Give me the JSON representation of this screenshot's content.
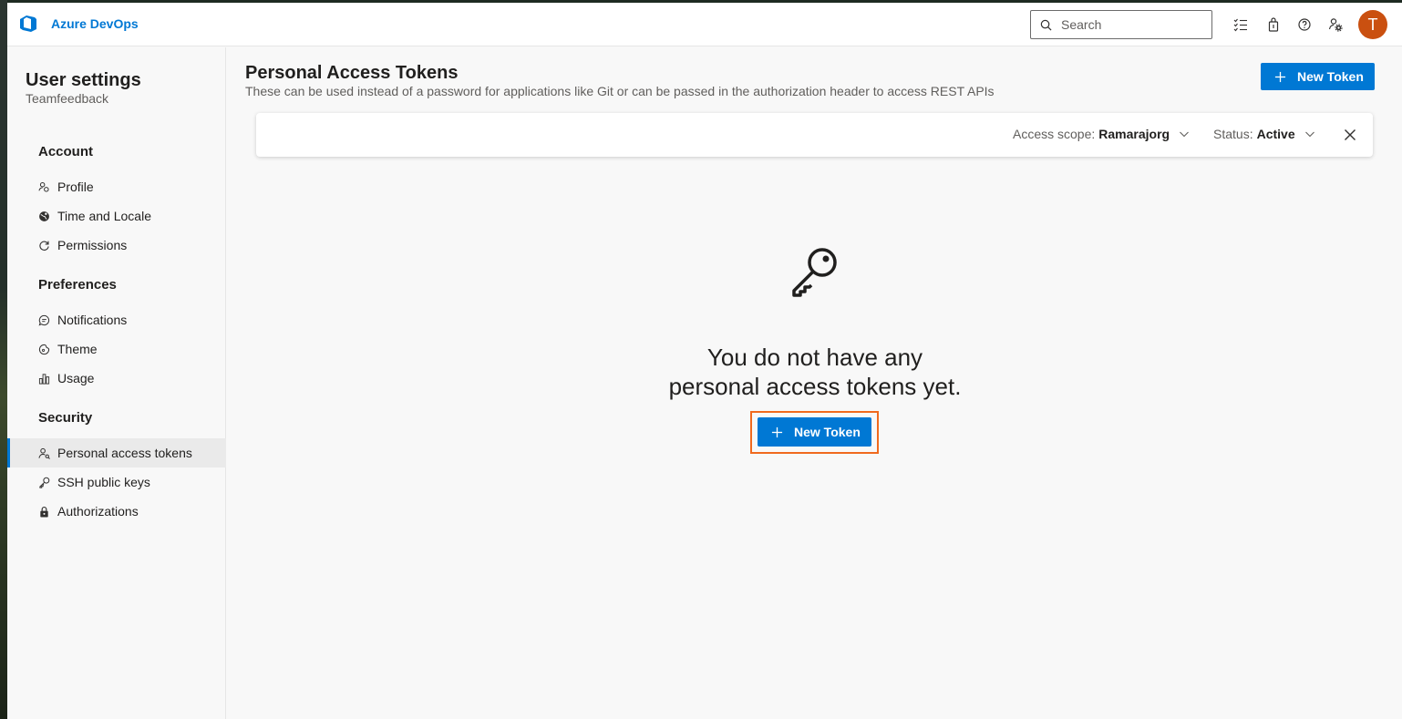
{
  "topbar": {
    "brand": "Azure DevOps",
    "search_placeholder": "Search",
    "avatar_initial": "T",
    "avatar_color": "#ca5010",
    "icons": [
      "task-list-icon",
      "shopping-bag-icon",
      "help-icon",
      "user-settings-icon"
    ]
  },
  "sidebar": {
    "title": "User settings",
    "org": "Teamfeedback",
    "groups": [
      {
        "label": "Account",
        "items": [
          {
            "label": "Profile",
            "icon": "profile-icon"
          },
          {
            "label": "Time and Locale",
            "icon": "globe-icon"
          },
          {
            "label": "Permissions",
            "icon": "refresh-icon"
          }
        ]
      },
      {
        "label": "Preferences",
        "items": [
          {
            "label": "Notifications",
            "icon": "chat-icon"
          },
          {
            "label": "Theme",
            "icon": "theme-icon"
          },
          {
            "label": "Usage",
            "icon": "bar-chart-icon"
          }
        ]
      },
      {
        "label": "Security",
        "items": [
          {
            "label": "Personal access tokens",
            "icon": "token-icon",
            "selected": true
          },
          {
            "label": "SSH public keys",
            "icon": "key-icon"
          },
          {
            "label": "Authorizations",
            "icon": "lock-icon"
          }
        ]
      }
    ]
  },
  "main": {
    "title": "Personal Access Tokens",
    "description": "These can be used instead of a password for applications like Git or can be passed in the authorization header to access REST APIs",
    "new_token_label": "New Token",
    "filters": {
      "scope_label": "Access scope:",
      "scope_value": "Ramarajorg",
      "status_label": "Status:",
      "status_value": "Active"
    },
    "empty_line1": "You do not have any",
    "empty_line2": "personal access tokens yet.",
    "empty_button_label": "New Token"
  },
  "colors": {
    "accent": "#0078d4",
    "highlight": "#f06a1e"
  }
}
